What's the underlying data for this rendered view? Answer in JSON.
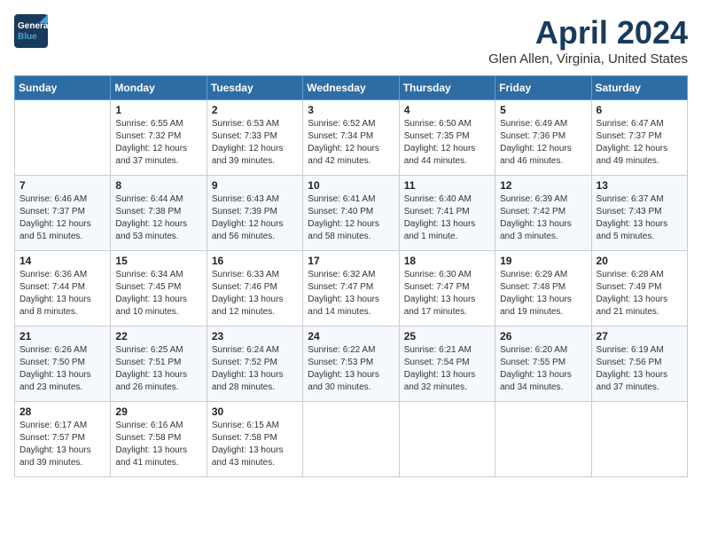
{
  "header": {
    "logo_line1": "General",
    "logo_line2": "Blue",
    "title": "April 2024",
    "subtitle": "Glen Allen, Virginia, United States"
  },
  "calendar": {
    "weekdays": [
      "Sunday",
      "Monday",
      "Tuesday",
      "Wednesday",
      "Thursday",
      "Friday",
      "Saturday"
    ],
    "weeks": [
      [
        {
          "day": "",
          "info": ""
        },
        {
          "day": "1",
          "info": "Sunrise: 6:55 AM\nSunset: 7:32 PM\nDaylight: 12 hours\nand 37 minutes."
        },
        {
          "day": "2",
          "info": "Sunrise: 6:53 AM\nSunset: 7:33 PM\nDaylight: 12 hours\nand 39 minutes."
        },
        {
          "day": "3",
          "info": "Sunrise: 6:52 AM\nSunset: 7:34 PM\nDaylight: 12 hours\nand 42 minutes."
        },
        {
          "day": "4",
          "info": "Sunrise: 6:50 AM\nSunset: 7:35 PM\nDaylight: 12 hours\nand 44 minutes."
        },
        {
          "day": "5",
          "info": "Sunrise: 6:49 AM\nSunset: 7:36 PM\nDaylight: 12 hours\nand 46 minutes."
        },
        {
          "day": "6",
          "info": "Sunrise: 6:47 AM\nSunset: 7:37 PM\nDaylight: 12 hours\nand 49 minutes."
        }
      ],
      [
        {
          "day": "7",
          "info": "Sunrise: 6:46 AM\nSunset: 7:37 PM\nDaylight: 12 hours\nand 51 minutes."
        },
        {
          "day": "8",
          "info": "Sunrise: 6:44 AM\nSunset: 7:38 PM\nDaylight: 12 hours\nand 53 minutes."
        },
        {
          "day": "9",
          "info": "Sunrise: 6:43 AM\nSunset: 7:39 PM\nDaylight: 12 hours\nand 56 minutes."
        },
        {
          "day": "10",
          "info": "Sunrise: 6:41 AM\nSunset: 7:40 PM\nDaylight: 12 hours\nand 58 minutes."
        },
        {
          "day": "11",
          "info": "Sunrise: 6:40 AM\nSunset: 7:41 PM\nDaylight: 13 hours\nand 1 minute."
        },
        {
          "day": "12",
          "info": "Sunrise: 6:39 AM\nSunset: 7:42 PM\nDaylight: 13 hours\nand 3 minutes."
        },
        {
          "day": "13",
          "info": "Sunrise: 6:37 AM\nSunset: 7:43 PM\nDaylight: 13 hours\nand 5 minutes."
        }
      ],
      [
        {
          "day": "14",
          "info": "Sunrise: 6:36 AM\nSunset: 7:44 PM\nDaylight: 13 hours\nand 8 minutes."
        },
        {
          "day": "15",
          "info": "Sunrise: 6:34 AM\nSunset: 7:45 PM\nDaylight: 13 hours\nand 10 minutes."
        },
        {
          "day": "16",
          "info": "Sunrise: 6:33 AM\nSunset: 7:46 PM\nDaylight: 13 hours\nand 12 minutes."
        },
        {
          "day": "17",
          "info": "Sunrise: 6:32 AM\nSunset: 7:47 PM\nDaylight: 13 hours\nand 14 minutes."
        },
        {
          "day": "18",
          "info": "Sunrise: 6:30 AM\nSunset: 7:47 PM\nDaylight: 13 hours\nand 17 minutes."
        },
        {
          "day": "19",
          "info": "Sunrise: 6:29 AM\nSunset: 7:48 PM\nDaylight: 13 hours\nand 19 minutes."
        },
        {
          "day": "20",
          "info": "Sunrise: 6:28 AM\nSunset: 7:49 PM\nDaylight: 13 hours\nand 21 minutes."
        }
      ],
      [
        {
          "day": "21",
          "info": "Sunrise: 6:26 AM\nSunset: 7:50 PM\nDaylight: 13 hours\nand 23 minutes."
        },
        {
          "day": "22",
          "info": "Sunrise: 6:25 AM\nSunset: 7:51 PM\nDaylight: 13 hours\nand 26 minutes."
        },
        {
          "day": "23",
          "info": "Sunrise: 6:24 AM\nSunset: 7:52 PM\nDaylight: 13 hours\nand 28 minutes."
        },
        {
          "day": "24",
          "info": "Sunrise: 6:22 AM\nSunset: 7:53 PM\nDaylight: 13 hours\nand 30 minutes."
        },
        {
          "day": "25",
          "info": "Sunrise: 6:21 AM\nSunset: 7:54 PM\nDaylight: 13 hours\nand 32 minutes."
        },
        {
          "day": "26",
          "info": "Sunrise: 6:20 AM\nSunset: 7:55 PM\nDaylight: 13 hours\nand 34 minutes."
        },
        {
          "day": "27",
          "info": "Sunrise: 6:19 AM\nSunset: 7:56 PM\nDaylight: 13 hours\nand 37 minutes."
        }
      ],
      [
        {
          "day": "28",
          "info": "Sunrise: 6:17 AM\nSunset: 7:57 PM\nDaylight: 13 hours\nand 39 minutes."
        },
        {
          "day": "29",
          "info": "Sunrise: 6:16 AM\nSunset: 7:58 PM\nDaylight: 13 hours\nand 41 minutes."
        },
        {
          "day": "30",
          "info": "Sunrise: 6:15 AM\nSunset: 7:58 PM\nDaylight: 13 hours\nand 43 minutes."
        },
        {
          "day": "",
          "info": ""
        },
        {
          "day": "",
          "info": ""
        },
        {
          "day": "",
          "info": ""
        },
        {
          "day": "",
          "info": ""
        }
      ]
    ]
  }
}
